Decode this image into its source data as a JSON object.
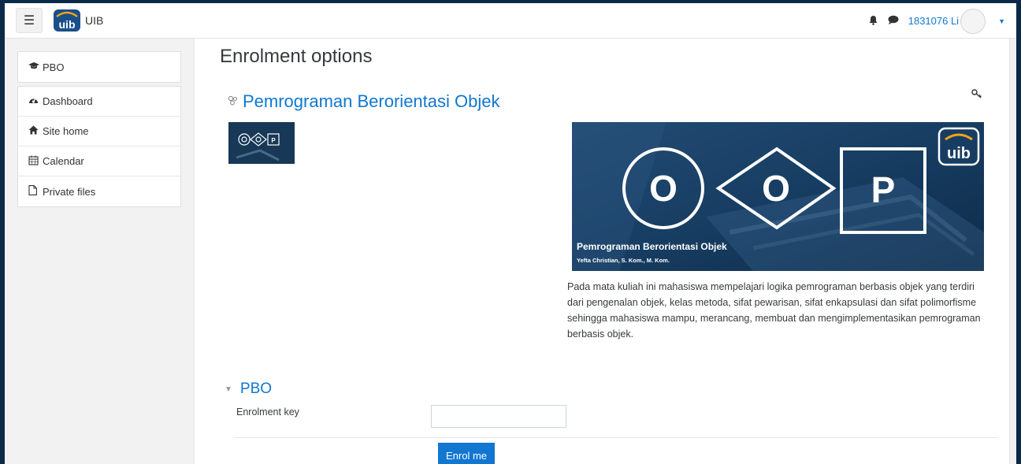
{
  "navbar": {
    "brand_name": "UIB",
    "brand_logo_text": "uib",
    "user_name": "1831076 Li"
  },
  "sidebar": {
    "course_item": {
      "label": "PBO",
      "icon": "graduation-cap-icon"
    },
    "items": [
      {
        "label": "Dashboard",
        "icon": "dashboard-icon"
      },
      {
        "label": "Site home",
        "icon": "home-icon"
      },
      {
        "label": "Calendar",
        "icon": "calendar-icon"
      },
      {
        "label": "Private files",
        "icon": "file-icon"
      }
    ]
  },
  "main": {
    "page_title": "Enrolment options",
    "course_title": "Pemrograman Berorientasi Objek",
    "banner": {
      "letters": [
        "O",
        "O",
        "P"
      ],
      "logo_text": "uib",
      "title": "Pemrograman Berorientasi Objek",
      "subtitle": "Yefta Christian, S. Kom., M. Kom."
    },
    "thumbnail_letter": "P",
    "description": "Pada mata kuliah ini mahasiswa mempelajari logika pemrograman berbasis objek yang terdiri dari pengenalan objek, kelas metoda, sifat pewarisan, sifat enkapsulasi dan sifat polimorfisme sehingga mahasiswa mampu, merancang, membuat dan mengimplementasikan pemrograman berbasis objek.",
    "section_title": "PBO",
    "enrolment_key_label": "Enrolment key",
    "enrolment_key_value": "",
    "enrol_button": "Enrol me"
  },
  "colors": {
    "link": "#1177d1",
    "frame": "#0b2a4a",
    "banner_bg": "#163a5c"
  }
}
